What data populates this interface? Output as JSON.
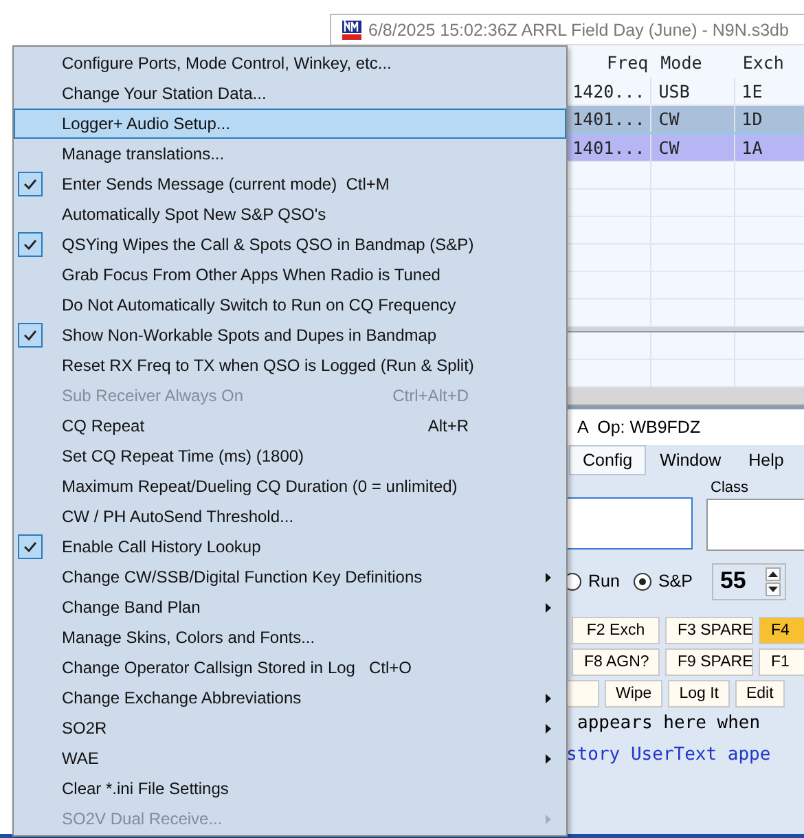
{
  "log_window": {
    "title": "6/8/2025 15:02:36Z  ARRL Field Day (June) - N9N.s3db",
    "columns": [
      "Freq",
      "Mode",
      "Exch"
    ],
    "rows": [
      {
        "cells": [
          "1420...",
          "USB",
          "1E"
        ],
        "selected": false,
        "color": "#f2f8fd"
      },
      {
        "cells": [
          "1401...",
          "CW",
          "1D"
        ],
        "selected": true,
        "color": "#aabfd9"
      },
      {
        "cells": [
          "1401...",
          "CW",
          "1A"
        ],
        "selected": false,
        "color": "#b6b6f5"
      }
    ]
  },
  "entry_window": {
    "title": "A  Op: WB9FDZ",
    "menus": [
      {
        "label": "Config",
        "selected": true
      },
      {
        "label": "Window",
        "selected": false
      },
      {
        "label": "Help",
        "selected": false
      }
    ],
    "class_label": "Class",
    "radios": [
      {
        "label": "Run",
        "selected": false
      },
      {
        "label": "S&P",
        "selected": true
      }
    ],
    "speed": "55",
    "key_rows": [
      [
        {
          "label": "F2 Exch",
          "active": false
        },
        {
          "label": "F3 SPARE",
          "active": false
        },
        {
          "label": "F4",
          "active": true
        }
      ],
      [
        {
          "label": "F8 AGN?",
          "active": false
        },
        {
          "label": "F9 SPARE",
          "active": false
        },
        {
          "label": "F1",
          "active": false
        }
      ],
      [
        {
          "label": "Wipe",
          "active": false
        },
        {
          "label": "Log It",
          "active": false
        },
        {
          "label": "Edit",
          "active": false
        }
      ]
    ],
    "info_lines": [
      {
        "text": "appears here when",
        "kind": "plain"
      },
      {
        "text": "story UserText appe",
        "kind": "link"
      }
    ]
  },
  "menu": {
    "items": [
      {
        "label": "Configure Ports, Mode Control, Winkey, etc...",
        "checked": false,
        "disabled": false,
        "selected": false,
        "submenu": false
      },
      {
        "label": "Change Your Station Data...",
        "checked": false,
        "disabled": false,
        "selected": false,
        "submenu": false
      },
      {
        "label": "Logger+ Audio Setup...",
        "checked": false,
        "disabled": false,
        "selected": true,
        "submenu": false
      },
      {
        "label": "Manage translations...",
        "checked": false,
        "disabled": false,
        "selected": false,
        "submenu": false
      },
      {
        "label": "Enter Sends Message (current mode)  Ctl+M",
        "checked": true,
        "disabled": false,
        "selected": false,
        "submenu": false
      },
      {
        "label": "Automatically Spot New S&P QSO's",
        "checked": false,
        "disabled": false,
        "selected": false,
        "submenu": false
      },
      {
        "label": "QSYing Wipes the Call & Spots QSO in Bandmap (S&P)",
        "checked": true,
        "disabled": false,
        "selected": false,
        "submenu": false
      },
      {
        "label": "Grab Focus From Other Apps When Radio is Tuned",
        "checked": false,
        "disabled": false,
        "selected": false,
        "submenu": false
      },
      {
        "label": "Do Not Automatically Switch to Run on CQ Frequency",
        "checked": false,
        "disabled": false,
        "selected": false,
        "submenu": false
      },
      {
        "label": "Show Non-Workable Spots and Dupes in Bandmap",
        "checked": true,
        "disabled": false,
        "selected": false,
        "submenu": false
      },
      {
        "label": "Reset RX Freq to TX when QSO is Logged (Run & Split)",
        "checked": false,
        "disabled": false,
        "selected": false,
        "submenu": false
      },
      {
        "label": "Sub Receiver Always On",
        "shortcut": "Ctrl+Alt+D",
        "checked": false,
        "disabled": true,
        "selected": false,
        "submenu": false
      },
      {
        "label": "CQ Repeat",
        "shortcut": "Alt+R",
        "checked": false,
        "disabled": false,
        "selected": false,
        "submenu": false
      },
      {
        "label": "Set CQ Repeat Time (ms) (1800)",
        "checked": false,
        "disabled": false,
        "selected": false,
        "submenu": false
      },
      {
        "label": "Maximum Repeat/Dueling CQ Duration (0 = unlimited)",
        "checked": false,
        "disabled": false,
        "selected": false,
        "submenu": false
      },
      {
        "label": "CW / PH AutoSend Threshold...",
        "checked": false,
        "disabled": false,
        "selected": false,
        "submenu": false
      },
      {
        "label": "Enable Call History Lookup",
        "checked": true,
        "disabled": false,
        "selected": false,
        "submenu": false
      },
      {
        "label": "Change CW/SSB/Digital Function Key Definitions",
        "checked": false,
        "disabled": false,
        "selected": false,
        "submenu": true
      },
      {
        "label": "Change Band Plan",
        "checked": false,
        "disabled": false,
        "selected": false,
        "submenu": true
      },
      {
        "label": "Manage Skins, Colors and Fonts...",
        "checked": false,
        "disabled": false,
        "selected": false,
        "submenu": false
      },
      {
        "label": "Change Operator Callsign Stored in Log   Ctl+O",
        "checked": false,
        "disabled": false,
        "selected": false,
        "submenu": false
      },
      {
        "label": "Change Exchange Abbreviations",
        "checked": false,
        "disabled": false,
        "selected": false,
        "submenu": true
      },
      {
        "label": "SO2R",
        "checked": false,
        "disabled": false,
        "selected": false,
        "submenu": true
      },
      {
        "label": "WAE",
        "checked": false,
        "disabled": false,
        "selected": false,
        "submenu": true
      },
      {
        "label": "Clear *.ini File Settings",
        "checked": false,
        "disabled": false,
        "selected": false,
        "submenu": false
      },
      {
        "label": "SO2V Dual Receive...",
        "checked": false,
        "disabled": true,
        "selected": false,
        "submenu": true
      }
    ]
  }
}
